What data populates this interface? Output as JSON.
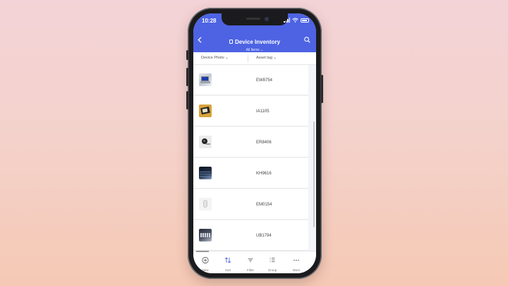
{
  "status_bar": {
    "time": "10:28"
  },
  "app_bar": {
    "title": "Device Inventory",
    "subtitle": "All Items ⌄",
    "back_icon": "chevron-left-icon",
    "search_icon": "search-icon",
    "color": "#4d63e4"
  },
  "columns": {
    "photo": "Device Photo ⌄",
    "asset_tag": "Asset tag ⌄"
  },
  "rows": [
    {
      "asset_tag": "EW8754",
      "photo": "laptop-photo"
    },
    {
      "asset_tag": "IA1105",
      "photo": "tablet-photo"
    },
    {
      "asset_tag": "ER8406",
      "photo": "webcam-photo"
    },
    {
      "asset_tag": "KH9616",
      "photo": "keyboard-photo"
    },
    {
      "asset_tag": "EM0154",
      "photo": "mouse-photo"
    },
    {
      "asset_tag": "UB1794",
      "photo": "keyboard-photo"
    }
  ],
  "toolbar": {
    "items": [
      {
        "label": "New",
        "icon": "plus-circle-icon"
      },
      {
        "label": "Sort",
        "icon": "sort-icon"
      },
      {
        "label": "Filter",
        "icon": "filter-icon"
      },
      {
        "label": "Group",
        "icon": "group-icon"
      },
      {
        "label": "More",
        "icon": "more-icon"
      }
    ]
  }
}
